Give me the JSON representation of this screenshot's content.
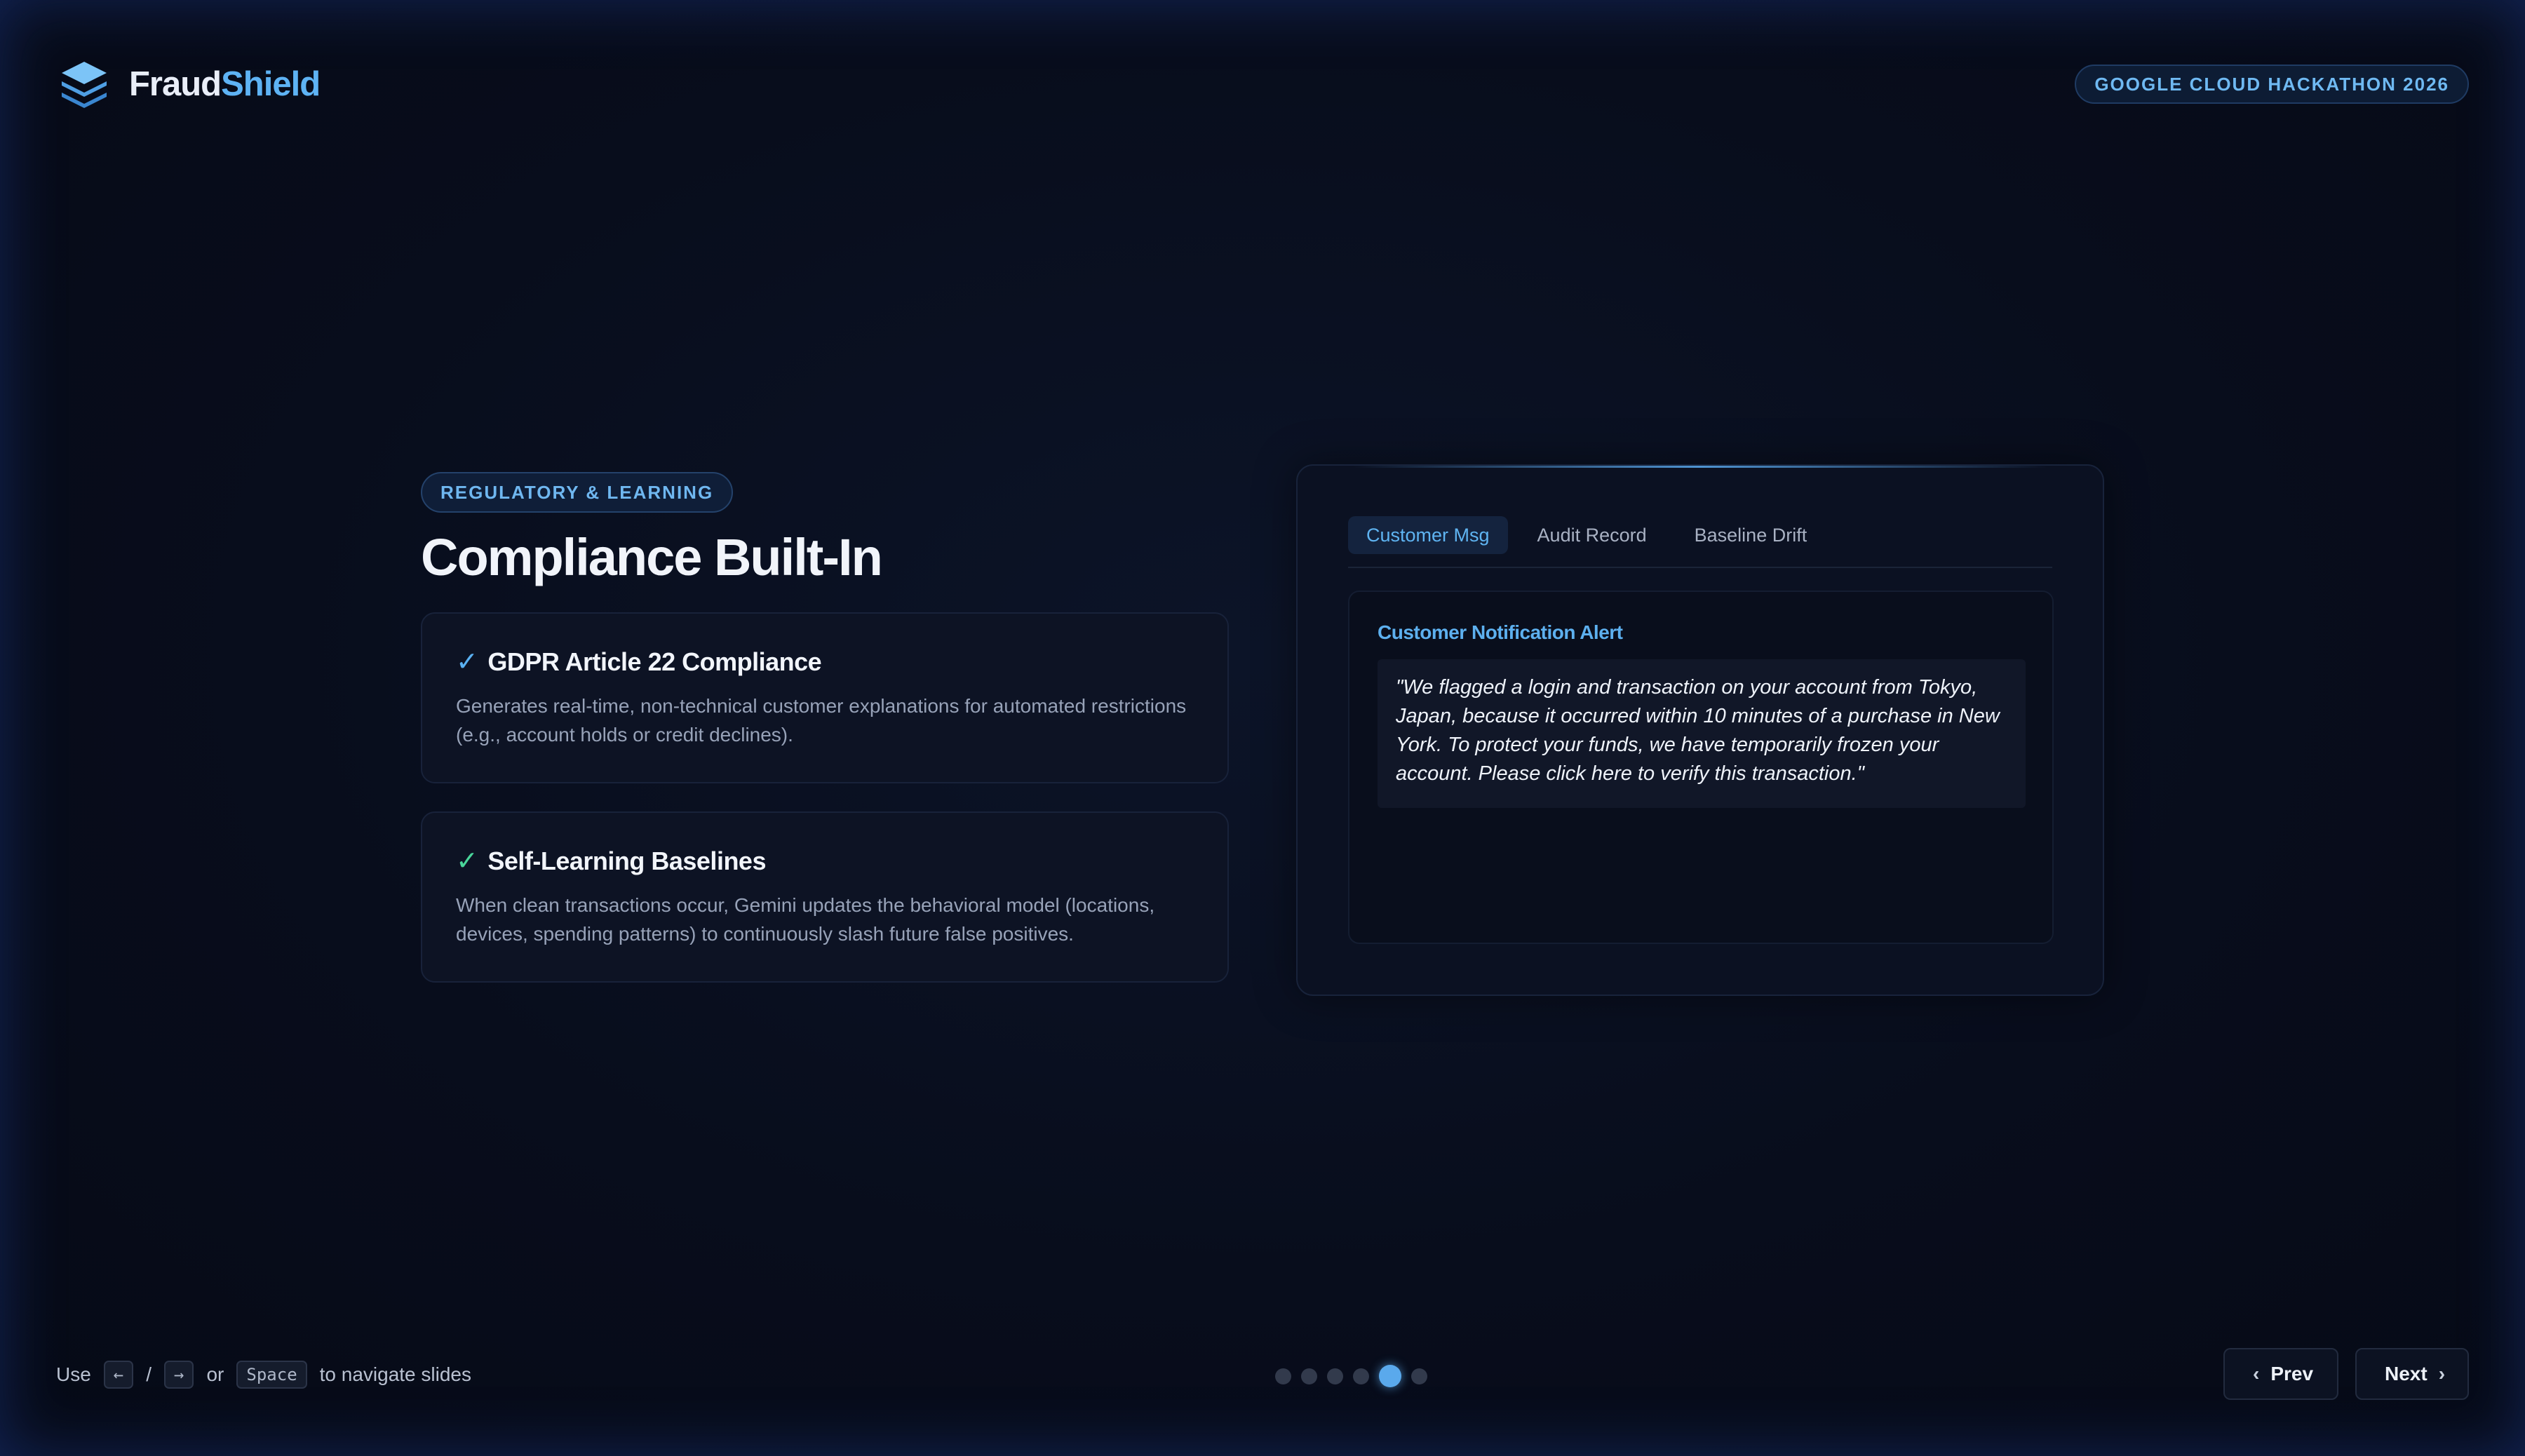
{
  "header": {
    "brand_part1": "Fraud",
    "brand_part2": "Shield",
    "event_badge": "GOOGLE CLOUD HACKATHON 2026"
  },
  "slide": {
    "tag": "REGULATORY & LEARNING",
    "title": "Compliance Built-In",
    "cards": [
      {
        "check": "✓",
        "title": "GDPR Article 22 Compliance",
        "body": "Generates real-time, non-technical customer explanations for automated restrictions (e.g., account holds or credit declines)."
      },
      {
        "check": "✓",
        "title": "Self-Learning Baselines",
        "body": "When clean transactions occur, Gemini updates the behavioral model (locations, devices, spending patterns) to continuously slash future false positives."
      }
    ]
  },
  "panel": {
    "tabs": [
      "Customer Msg",
      "Audit Record",
      "Baseline Drift"
    ],
    "active_tab": "Customer Msg",
    "alert_title": "Customer Notification Alert",
    "message": "\"We flagged a login and transaction on your account from Tokyo, Japan, because it occurred within 10 minutes of a purchase in New York. To protect your funds, we have temporarily frozen your account. Please click here to verify this transaction.\""
  },
  "footer": {
    "hint_use": "Use",
    "key_left": "←",
    "slash": "/",
    "key_right": "→",
    "or": "or",
    "key_space": "Space",
    "hint_tail": "to navigate slides",
    "slide_count": 6,
    "current_slide": 5,
    "prev_label": "Prev",
    "next_label": "Next"
  },
  "colors": {
    "accent": "#5eb3f4",
    "check_green": "#49d59a",
    "background": "#070b18"
  }
}
